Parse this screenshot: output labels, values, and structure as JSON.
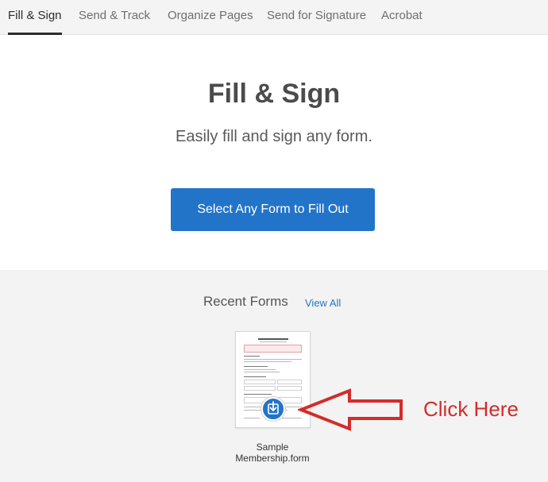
{
  "tabs": [
    {
      "label": "Fill & Sign",
      "active": true
    },
    {
      "label": "Send & Track",
      "active": false
    },
    {
      "label": "Organize Pages",
      "active": false
    },
    {
      "label": "Send for Signature",
      "active": false
    },
    {
      "label": "Acrobat",
      "active": false
    }
  ],
  "hero": {
    "title": "Fill & Sign",
    "subtitle": "Easily fill and sign any form.",
    "cta_label": "Select Any Form to Fill Out"
  },
  "recent": {
    "title": "Recent Forms",
    "view_all_label": "View All",
    "items": [
      {
        "name_line1": "Sample",
        "name_line2": "Membership.form",
        "badge_icon": "download-icon"
      }
    ]
  },
  "annotation": {
    "text": "Click Here",
    "color": "#d42b2b"
  },
  "colors": {
    "accent": "#2274c9",
    "tab_bar_bg": "#f4f4f4",
    "recent_bg": "#f3f3f3"
  }
}
